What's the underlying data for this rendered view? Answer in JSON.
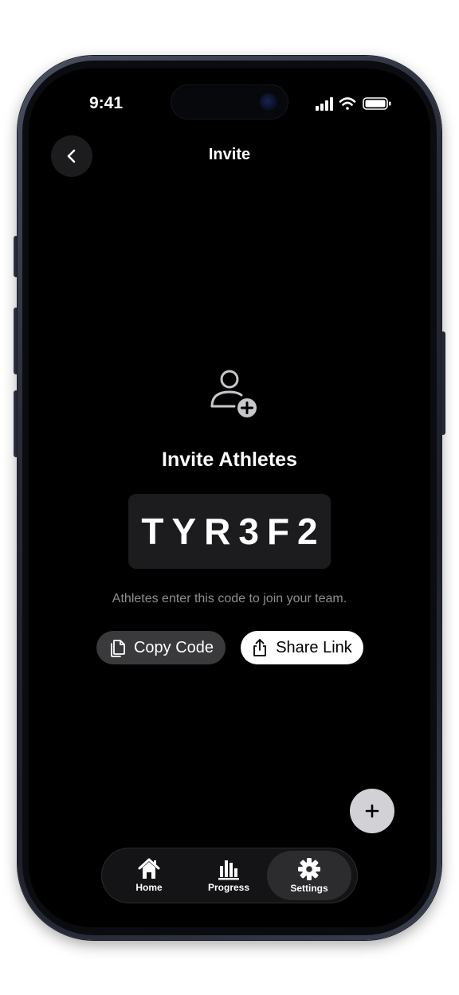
{
  "status_bar": {
    "time": "9:41"
  },
  "header": {
    "title": "Invite"
  },
  "main": {
    "heading": "Invite Athletes",
    "invite_code": "TYR3F2",
    "hint": "Athletes enter this code to join your team.",
    "copy_button_label": "Copy Code",
    "share_button_label": "Share Link"
  },
  "tabs": [
    {
      "label": "Home",
      "icon": "house-icon",
      "selected": false
    },
    {
      "label": "Progress",
      "icon": "bar-chart-icon",
      "selected": false
    },
    {
      "label": "Settings",
      "icon": "gear-icon",
      "selected": true
    }
  ],
  "colors": {
    "background": "#000000",
    "surface": "#1c1c1e",
    "secondary_button": "#3a3a3c",
    "primary_button": "#ffffff",
    "muted_text": "#8e8e93",
    "fab": "#d1d1d6"
  }
}
